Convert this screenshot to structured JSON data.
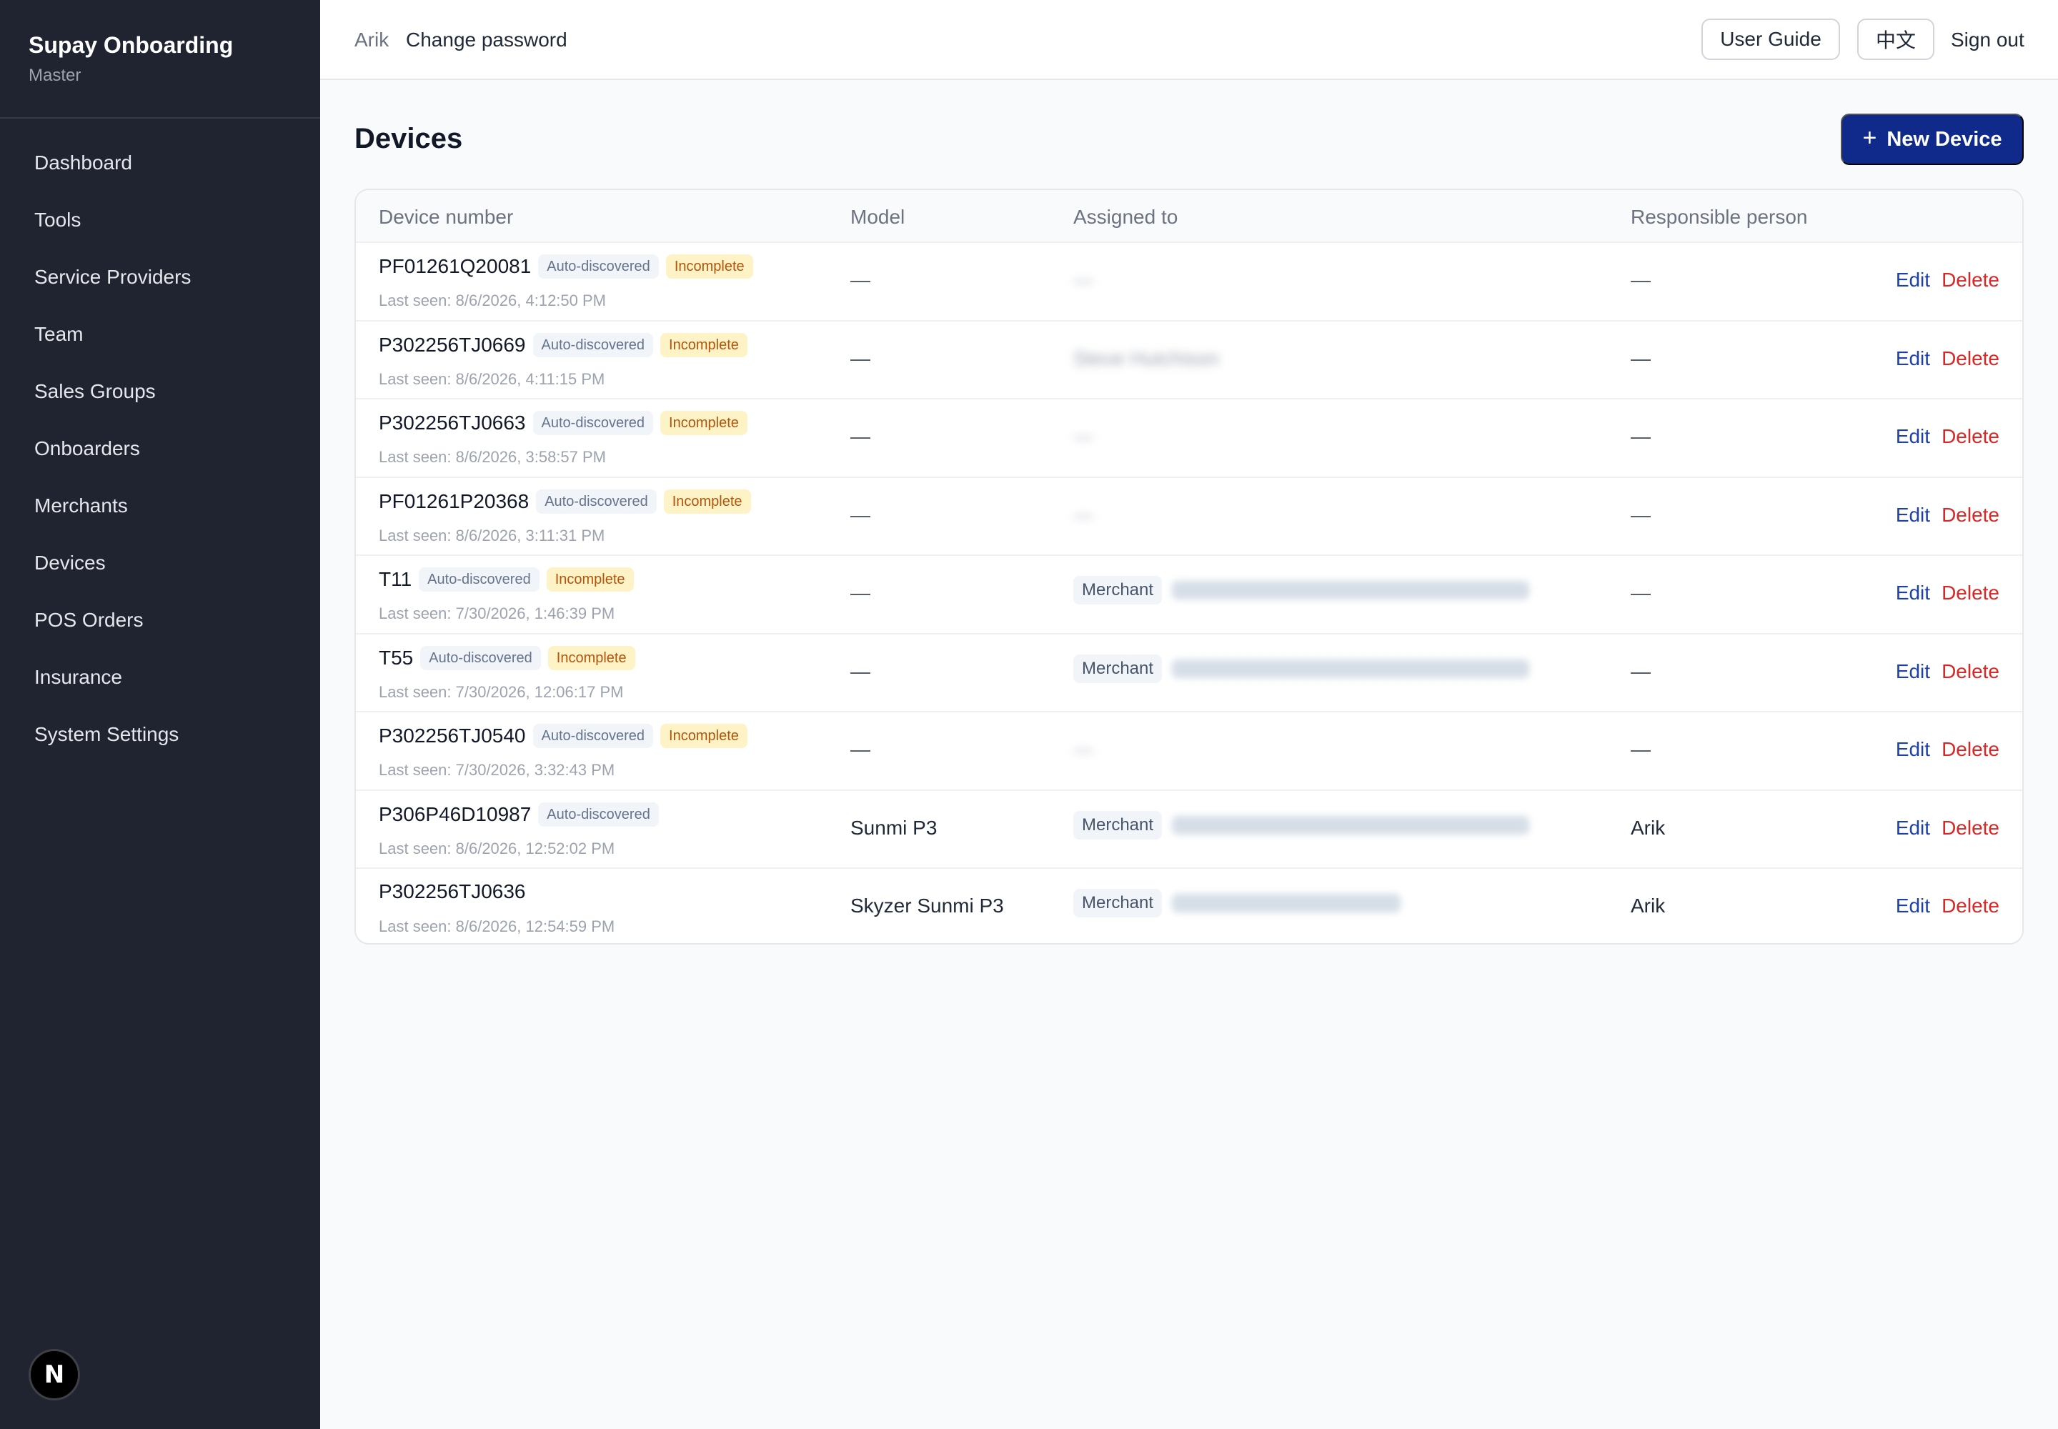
{
  "sidebar": {
    "title": "Supay Onboarding",
    "subtitle": "Master",
    "items": [
      {
        "label": "Dashboard"
      },
      {
        "label": "Tools"
      },
      {
        "label": "Service Providers"
      },
      {
        "label": "Team"
      },
      {
        "label": "Sales Groups"
      },
      {
        "label": "Onboarders"
      },
      {
        "label": "Merchants"
      },
      {
        "label": "Devices"
      },
      {
        "label": "POS Orders"
      },
      {
        "label": "Insurance"
      },
      {
        "label": "System Settings"
      }
    ],
    "badge": "N"
  },
  "topbar": {
    "user": "Arik",
    "change_password": "Change password",
    "user_guide": "User Guide",
    "language": "中文",
    "sign_out": "Sign out"
  },
  "page": {
    "title": "Devices",
    "new_button": "New Device",
    "new_button_icon": "+"
  },
  "table": {
    "headers": {
      "device": "Device number",
      "model": "Model",
      "assigned": "Assigned to",
      "responsible": "Responsible person"
    },
    "edit_label": "Edit",
    "delete_label": "Delete",
    "merchant_label": "Merchant",
    "auto_label": "Auto-discovered",
    "incomplete_label": "Incomplete",
    "rows": [
      {
        "device": "PF01261Q20081",
        "auto": true,
        "incomplete": true,
        "last_seen": "Last seen: 8/6/2026, 4:12:50 PM",
        "model": "—",
        "assigned_type": "blurred-dash",
        "assigned": "—",
        "responsible": "—"
      },
      {
        "device": "P302256TJ0669",
        "auto": true,
        "incomplete": true,
        "last_seen": "Last seen: 8/6/2026, 4:11:15 PM",
        "model": "—",
        "assigned_type": "blurred-text",
        "assigned": "Steve Hutchison",
        "responsible": "—"
      },
      {
        "device": "P302256TJ0663",
        "auto": true,
        "incomplete": true,
        "last_seen": "Last seen: 8/6/2026, 3:58:57 PM",
        "model": "—",
        "assigned_type": "blurred-dash",
        "assigned": "—",
        "responsible": "—"
      },
      {
        "device": "PF01261P20368",
        "auto": true,
        "incomplete": true,
        "last_seen": "Last seen: 8/6/2026, 3:11:31 PM",
        "model": "—",
        "assigned_type": "blurred-dash",
        "assigned": "—",
        "responsible": "—"
      },
      {
        "device": "T11",
        "auto": true,
        "incomplete": true,
        "last_seen": "Last seen: 7/30/2026, 1:46:39 PM",
        "model": "—",
        "assigned_type": "merchant",
        "responsible": "—"
      },
      {
        "device": "T55",
        "auto": true,
        "incomplete": true,
        "last_seen": "Last seen: 7/30/2026, 12:06:17 PM",
        "model": "—",
        "assigned_type": "merchant",
        "responsible": "—"
      },
      {
        "device": "P302256TJ0540",
        "auto": true,
        "incomplete": true,
        "last_seen": "Last seen: 7/30/2026, 3:32:43 PM",
        "model": "—",
        "assigned_type": "blurred-dash",
        "assigned": "—",
        "responsible": "—"
      },
      {
        "device": "P306P46D10987",
        "auto": true,
        "incomplete": false,
        "last_seen": "Last seen: 8/6/2026, 12:52:02 PM",
        "model": "Sunmi P3",
        "assigned_type": "merchant",
        "responsible": "Arik"
      },
      {
        "device": "P302256TJ0636",
        "auto": false,
        "incomplete": false,
        "last_seen": "Last seen: 8/6/2026, 12:54:59 PM",
        "model": "Skyzer Sunmi P3",
        "assigned_type": "merchant-short",
        "responsible": "Arik"
      }
    ]
  }
}
